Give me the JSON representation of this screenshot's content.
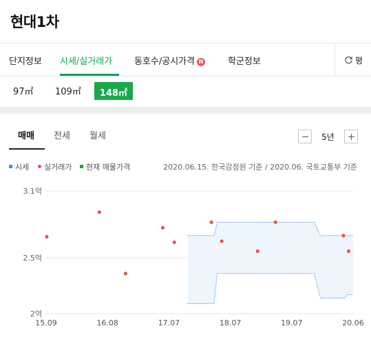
{
  "page": {
    "title": "현대1차"
  },
  "tabs": [
    {
      "label": "단지정보",
      "active": false
    },
    {
      "label": "시세/실거래가",
      "active": true
    },
    {
      "label": "동호수/공시가격",
      "active": false,
      "badge": "N"
    },
    {
      "label": "학군정보",
      "active": false
    }
  ],
  "refresh": {
    "icon": "refresh-icon",
    "label": "평"
  },
  "sizes": [
    {
      "label": "97㎡",
      "active": false
    },
    {
      "label": "109㎡",
      "active": false
    },
    {
      "label": "148㎡",
      "active": true
    }
  ],
  "deal_tabs": [
    {
      "label": "매매",
      "active": true
    },
    {
      "label": "전세",
      "active": false
    },
    {
      "label": "월세",
      "active": false
    }
  ],
  "period": {
    "label": "5년",
    "minus_icon": "minus-icon",
    "plus_icon": "plus-icon"
  },
  "legend": {
    "market": "시세",
    "transaction": "실거래가",
    "listing": "현재 매물가격",
    "note": "2020.06.15. 한국감정원 기준 / 2020.06. 국토교통부 기준"
  },
  "colors": {
    "accent": "#0aa55a",
    "active_size": "#18a84a",
    "market": "#4a90e2",
    "transaction": "#e8504f",
    "listing": "#18a84a"
  },
  "chart_data": {
    "type": "scatter",
    "x_ticks": [
      "15.09",
      "16.08",
      "17.07",
      "18.07",
      "19.07",
      "20.06"
    ],
    "x_range": [
      2015.67,
      2020.46
    ],
    "y_ticks": [
      "3.1억",
      "2.5억",
      "2억"
    ],
    "y_tick_values": [
      3.1,
      2.5,
      2.0
    ],
    "y_range": [
      2.0,
      3.1
    ],
    "transactions": [
      {
        "x": 2015.68,
        "y": 2.69
      },
      {
        "x": 2016.5,
        "y": 2.91
      },
      {
        "x": 2016.91,
        "y": 2.36
      },
      {
        "x": 2017.49,
        "y": 2.77
      },
      {
        "x": 2017.67,
        "y": 2.64
      },
      {
        "x": 2018.25,
        "y": 2.82
      },
      {
        "x": 2018.41,
        "y": 2.65
      },
      {
        "x": 2018.97,
        "y": 2.56
      },
      {
        "x": 2019.25,
        "y": 2.82
      },
      {
        "x": 2020.31,
        "y": 2.7
      },
      {
        "x": 2020.39,
        "y": 2.56
      }
    ],
    "market_upper": [
      {
        "x": 2017.88,
        "y": 2.7
      },
      {
        "x": 2018.29,
        "y": 2.7
      },
      {
        "x": 2018.34,
        "y": 2.82
      },
      {
        "x": 2019.85,
        "y": 2.82
      },
      {
        "x": 2019.95,
        "y": 2.7
      },
      {
        "x": 2020.46,
        "y": 2.7
      }
    ],
    "market_lower": [
      {
        "x": 2017.88,
        "y": 2.09
      },
      {
        "x": 2018.29,
        "y": 2.09
      },
      {
        "x": 2018.34,
        "y": 2.36
      },
      {
        "x": 2019.85,
        "y": 2.36
      },
      {
        "x": 2019.95,
        "y": 2.14
      },
      {
        "x": 2020.33,
        "y": 2.14
      },
      {
        "x": 2020.37,
        "y": 2.17
      },
      {
        "x": 2020.46,
        "y": 2.17
      }
    ],
    "grid": true
  }
}
